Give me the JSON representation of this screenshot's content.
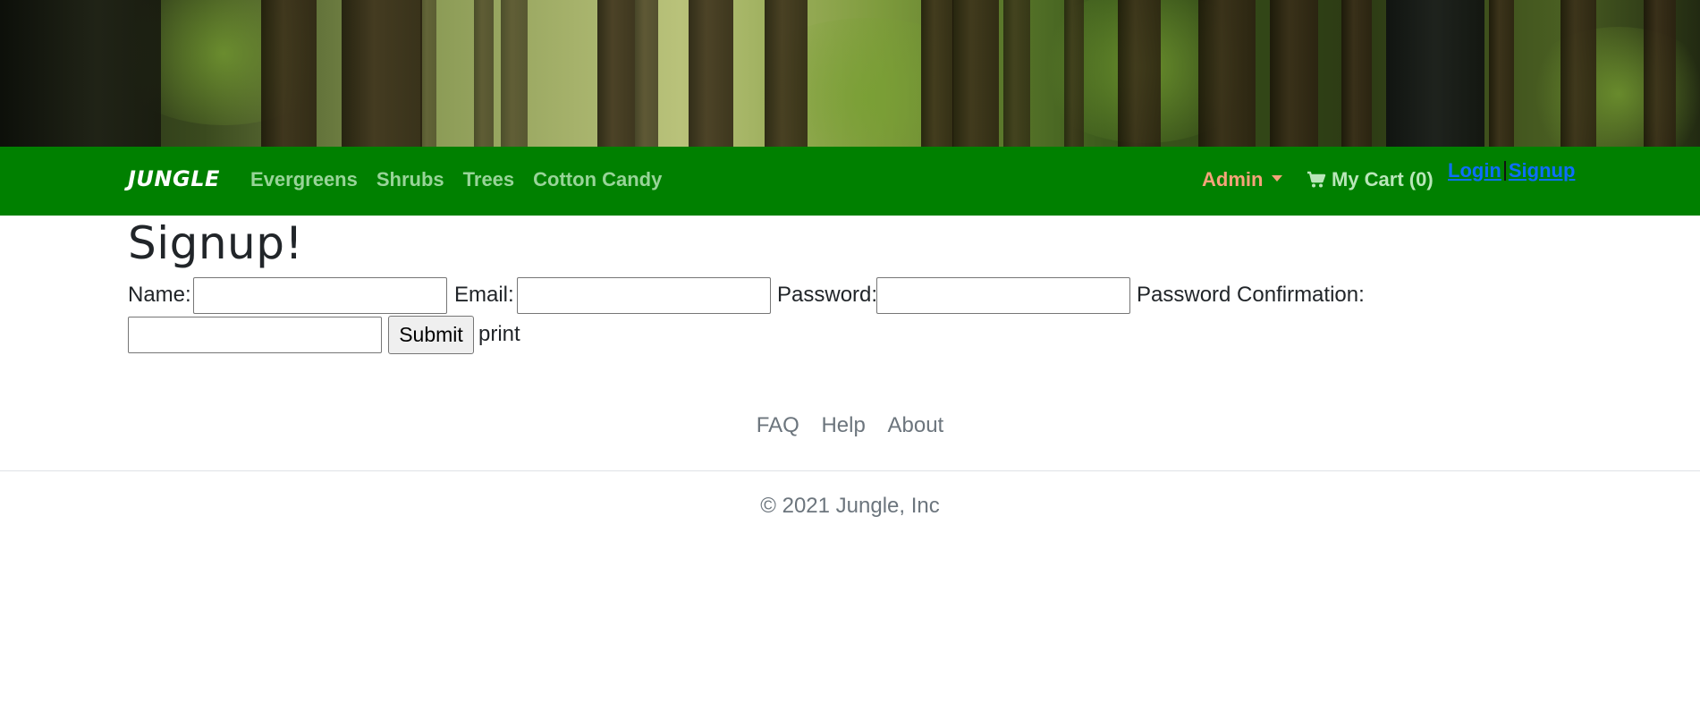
{
  "header": {
    "brand": "JUNGLE",
    "nav_links": [
      "Evergreens",
      "Shrubs",
      "Trees",
      "Cotton Candy"
    ],
    "admin_label": "Admin",
    "cart_label": "My Cart (0)",
    "login_label": "Login",
    "signup_label": "Signup"
  },
  "page": {
    "title": "Signup!"
  },
  "form": {
    "name_label": "Name:",
    "email_label": "Email:",
    "password_label": "Password:",
    "password_confirmation_label": "Password Confirmation:",
    "submit_label": "Submit",
    "trailing_text": "print",
    "name_value": "",
    "email_value": "",
    "password_value": "",
    "password_confirmation_value": ""
  },
  "footer": {
    "links": [
      "FAQ",
      "Help",
      "About"
    ],
    "copyright": "© 2021 Jungle, Inc"
  },
  "colors": {
    "navbar": "#008000",
    "nav_link": "#98d498",
    "admin": "#f7a37a",
    "auth_link": "#0d6efd",
    "muted": "#6c757d"
  },
  "icons": {
    "cart": "shopping-cart-icon",
    "admin_dropdown": "caret-down-icon"
  }
}
